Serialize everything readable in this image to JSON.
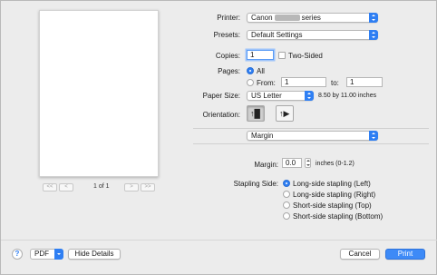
{
  "printer": {
    "label": "Printer:",
    "value_prefix": "Canon",
    "value_suffix": "series"
  },
  "presets": {
    "label": "Presets:",
    "value": "Default Settings"
  },
  "copies": {
    "label": "Copies:",
    "value": "1",
    "two_sided_label": "Two-Sided",
    "two_sided_checked": false
  },
  "pages": {
    "label": "Pages:",
    "all_label": "All",
    "from_label": "From:",
    "from_value": "1",
    "to_label": "to:",
    "to_value": "1",
    "selected": "All"
  },
  "paper_size": {
    "label": "Paper Size:",
    "value": "US Letter",
    "dimensions": "8.50 by 11.00 inches"
  },
  "orientation": {
    "label": "Orientation:",
    "selected": "portrait",
    "portrait_icon": "portrait-icon",
    "landscape_icon": "landscape-icon"
  },
  "section": {
    "value": "Margin"
  },
  "margin": {
    "label": "Margin:",
    "value": "0.0",
    "unit_text": "inches (0-1.2)"
  },
  "stapling": {
    "label": "Stapling Side:",
    "selected": "Long-side stapling (Left)",
    "options": [
      "Long-side stapling (Left)",
      "Long-side stapling (Right)",
      "Short-side stapling (Top)",
      "Short-side stapling (Bottom)"
    ]
  },
  "preview": {
    "page_info": "1 of 1",
    "first_icon": "first-page-icon",
    "prev_icon": "previous-page-icon",
    "next_icon": "next-page-icon",
    "last_icon": "last-page-icon"
  },
  "bottom": {
    "help": "?",
    "pdf": "PDF",
    "hide_details": "Hide Details",
    "cancel": "Cancel",
    "print": "Print"
  },
  "colors": {
    "accent": "#2f7ff3",
    "background": "#ececec"
  }
}
